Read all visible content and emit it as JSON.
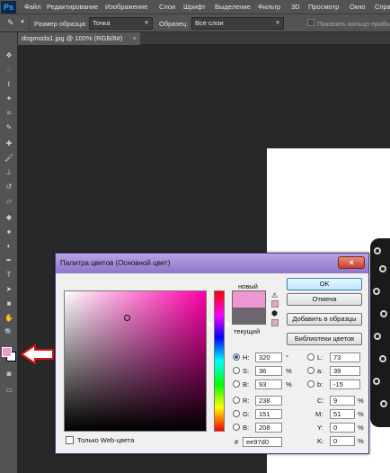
{
  "app": {
    "logo": "Ps",
    "menu": [
      "Файл",
      "Редактирование",
      "Изображение",
      "Слои",
      "Шрифт",
      "Выделение",
      "Фильтр",
      "3D",
      "Просмотр",
      "Окно",
      "Спра"
    ]
  },
  "options": {
    "sample_size_label": "Размер образца:",
    "sample_size_value": "Точка",
    "sample_label": "Образец:",
    "sample_value": "Все слои",
    "show_ring_label": "Показать кольцо пробы"
  },
  "document": {
    "tab_title": "dogmoda1.jpg @ 100% (RGB/8#)",
    "close_glyph": "×"
  },
  "dialog": {
    "title": "Палитра цветов (Основной цвет)",
    "close_glyph": "×",
    "new_label": "новый",
    "current_label": "текущий",
    "buttons": {
      "ok": "OK",
      "cancel": "Отмена",
      "add_swatches": "Добавить в образцы",
      "libraries": "Библиотеки цветов"
    },
    "hsb": [
      {
        "label": "H:",
        "value": "320",
        "unit": "°",
        "selected": true
      },
      {
        "label": "S:",
        "value": "36",
        "unit": "%",
        "selected": false
      },
      {
        "label": "B:",
        "value": "93",
        "unit": "%",
        "selected": false
      }
    ],
    "rgb": [
      {
        "label": "R:",
        "value": "238"
      },
      {
        "label": "G:",
        "value": "151"
      },
      {
        "label": "B:",
        "value": "208"
      }
    ],
    "lab": [
      {
        "label": "L:",
        "value": "73"
      },
      {
        "label": "a:",
        "value": "39"
      },
      {
        "label": "b:",
        "value": "-15"
      }
    ],
    "cmyk": [
      {
        "label": "C:",
        "value": "9",
        "unit": "%"
      },
      {
        "label": "M:",
        "value": "51",
        "unit": "%"
      },
      {
        "label": "Y:",
        "value": "0",
        "unit": "%"
      },
      {
        "label": "K:",
        "value": "0",
        "unit": "%"
      }
    ],
    "hex_label": "#",
    "hex_value": "ee97d0",
    "web_only_label": "Только Web-цвета",
    "colors": {
      "new": "#ee97d0",
      "current": "#6f6570"
    }
  }
}
